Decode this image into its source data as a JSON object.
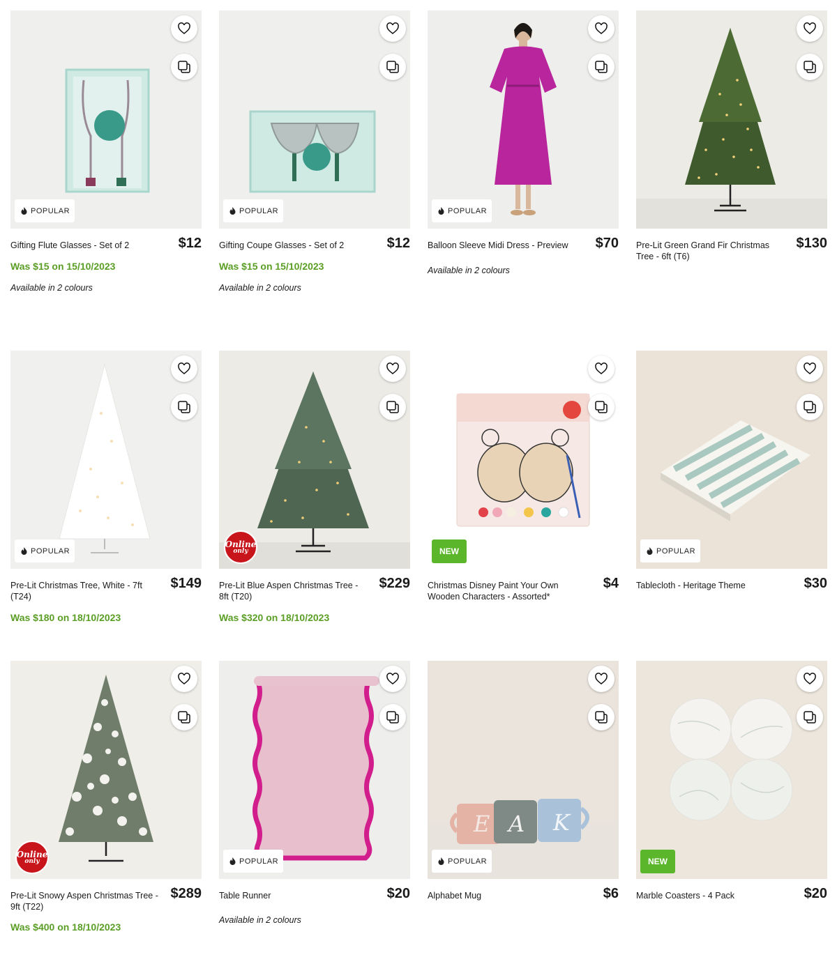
{
  "badges": {
    "popular": "POPULAR",
    "new": "NEW",
    "online_line1": "Online",
    "online_line2": "only"
  },
  "colors": {
    "sale_green": "#5a9e25",
    "new_badge": "#5cb62c",
    "online_badge": "#c8151b"
  },
  "icons": {
    "wishlist": "heart-icon",
    "compare": "compare-icon",
    "popular": "flame-icon"
  },
  "products": [
    {
      "title": "Gifting Flute Glasses - Set of 2",
      "price": "$12",
      "was": "Was $15 on 15/10/2023",
      "colours": "Available in 2 colours",
      "badge": "popular"
    },
    {
      "title": "Gifting Coupe Glasses - Set of 2",
      "price": "$12",
      "was": "Was $15 on 15/10/2023",
      "colours": "Available in 2 colours",
      "badge": "popular"
    },
    {
      "title": "Balloon Sleeve Midi Dress - Preview",
      "price": "$70",
      "colours": "Available in 2 colours",
      "badge": "popular"
    },
    {
      "title": "Pre-Lit Green Grand Fir Christmas Tree - 6ft (T6)",
      "price": "$130"
    },
    {
      "title": "Pre-Lit Christmas Tree, White - 7ft (T24)",
      "price": "$149",
      "was": "Was $180 on 18/10/2023",
      "badge": "popular"
    },
    {
      "title": "Pre-Lit Blue Aspen Christmas Tree - 8ft (T20)",
      "price": "$229",
      "was": "Was $320 on 18/10/2023",
      "badge": "online"
    },
    {
      "title": "Christmas Disney Paint Your Own Wooden Characters - Assorted*",
      "price": "$4",
      "badge": "new"
    },
    {
      "title": "Tablecloth - Heritage Theme",
      "price": "$30",
      "badge": "popular"
    },
    {
      "title": "Pre-Lit Snowy Aspen Christmas Tree - 9ft (T22)",
      "price": "$289",
      "was": "Was $400 on 18/10/2023",
      "badge": "online"
    },
    {
      "title": "Table Runner",
      "price": "$20",
      "colours": "Available in 2 colours",
      "badge": "popular"
    },
    {
      "title": "Alphabet Mug",
      "price": "$6",
      "badge": "popular"
    },
    {
      "title": "Marble Coasters - 4 Pack",
      "price": "$20",
      "badge": "new"
    }
  ]
}
